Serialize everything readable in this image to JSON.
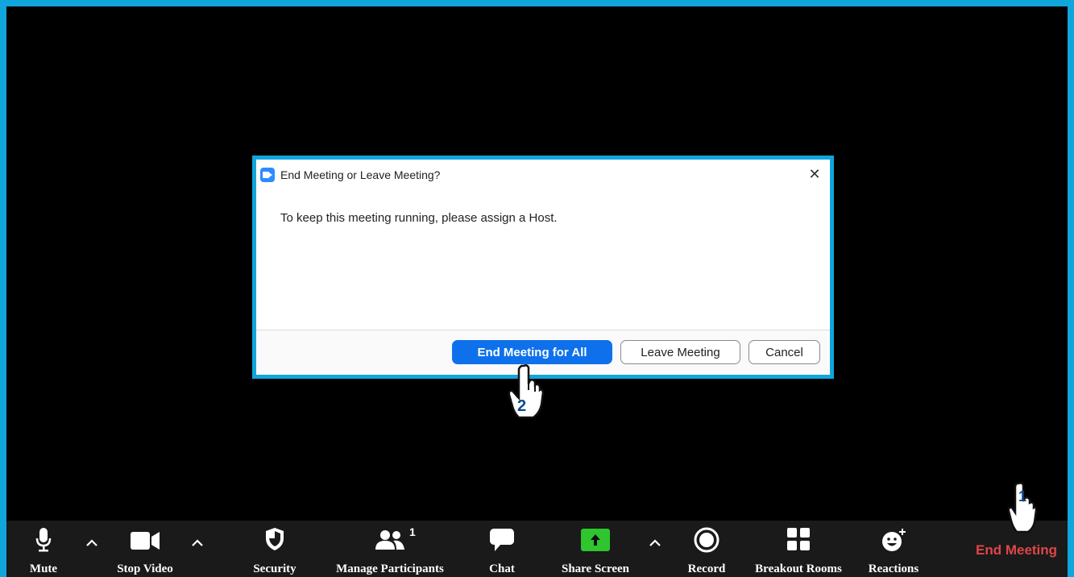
{
  "dialog": {
    "title": "End Meeting or Leave Meeting?",
    "close_glyph": "✕",
    "message": "To keep this meeting running, please assign a Host.",
    "buttons": {
      "end_for_all": "End Meeting for All",
      "leave": "Leave Meeting",
      "cancel": "Cancel"
    }
  },
  "annotations": {
    "step1": "1",
    "step2": "2"
  },
  "toolbar": {
    "mute": "Mute",
    "stop_video": "Stop Video",
    "security": "Security",
    "manage_participants": "Manage Participants",
    "participant_count": "1",
    "chat": "Chat",
    "share_screen": "Share Screen",
    "record": "Record",
    "breakout_rooms": "Breakout Rooms",
    "reactions": "Reactions",
    "end_meeting": "End Meeting"
  },
  "colors": {
    "highlight_border": "#10a6dc",
    "primary_button": "#0e71eb",
    "share_green": "#2ec52e",
    "end_red": "#e0454a"
  },
  "icons": [
    "zoom-app-icon",
    "close-icon",
    "microphone-icon",
    "chevron-up-icon",
    "video-camera-icon",
    "shield-icon",
    "participants-icon",
    "chat-bubble-icon",
    "share-screen-icon",
    "record-icon",
    "breakout-rooms-icon",
    "reactions-icon",
    "hand-pointer-icon"
  ]
}
